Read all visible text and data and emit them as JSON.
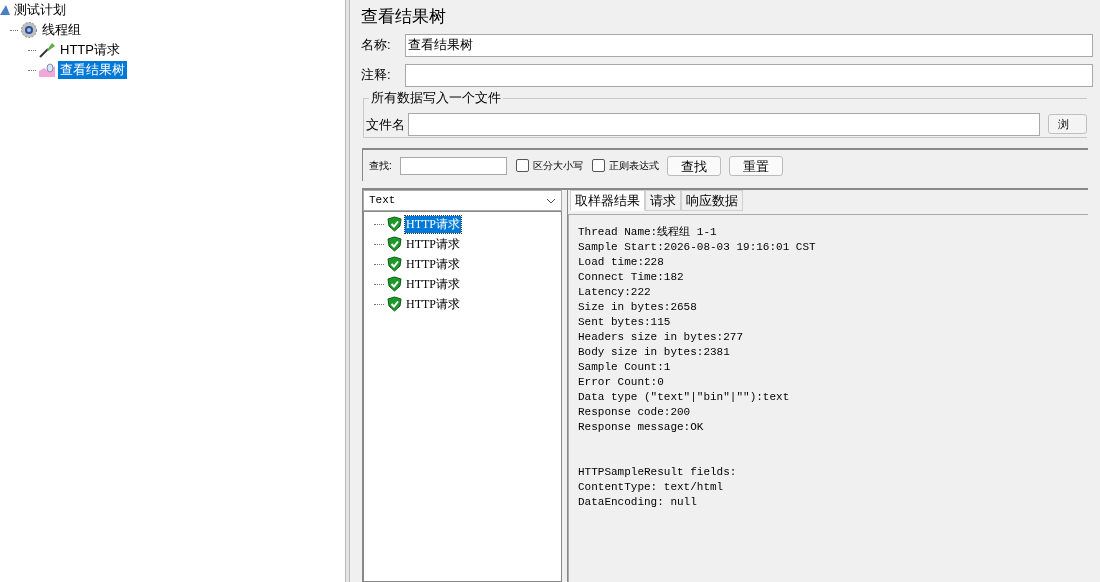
{
  "tree": [
    {
      "label": "测试计划",
      "kind": "plan",
      "selected": false,
      "children": [
        {
          "label": "线程组",
          "kind": "gear",
          "selected": false,
          "children": [
            {
              "label": "HTTP请求",
              "kind": "pipette",
              "selected": false
            },
            {
              "label": "查看结果树",
              "kind": "chart",
              "selected": true
            }
          ]
        }
      ]
    }
  ],
  "panel": {
    "title": "查看结果树",
    "name_label": "名称:",
    "name_value": "查看结果树",
    "comment_label": "注释:",
    "file_group": {
      "legend": "所有数据写入一个文件",
      "file_label": "文件名",
      "browse_button": "浏"
    }
  },
  "search": {
    "label": "查找:",
    "case_checkbox": {
      "label": "区分大小写",
      "checked": false
    },
    "regex_checkbox": {
      "label": "正则表达式",
      "checked": false
    },
    "find_button": "查找",
    "reset_button": "重置"
  },
  "renderer": {
    "value": "Text"
  },
  "results": [
    {
      "label": "HTTP请求",
      "selected": true,
      "success": true
    },
    {
      "label": "HTTP请求",
      "selected": false,
      "success": true
    },
    {
      "label": "HTTP请求",
      "selected": false,
      "success": true
    },
    {
      "label": "HTTP请求",
      "selected": false,
      "success": true
    },
    {
      "label": "HTTP请求",
      "selected": false,
      "success": true
    }
  ],
  "tabs": [
    {
      "label": "取样器结果",
      "selected": true
    },
    {
      "label": "请求",
      "selected": false
    },
    {
      "label": "响应数据",
      "selected": false
    }
  ],
  "sampler_result": {
    "lines": [
      "Thread Name:线程组 1-1",
      "Sample Start:2026-08-03 19:16:01 CST",
      "Load time:228",
      "Connect Time:182",
      "Latency:222",
      "Size in bytes:2658",
      "Sent bytes:115",
      "Headers size in bytes:277",
      "Body size in bytes:2381",
      "Sample Count:1",
      "Error Count:0",
      "Data type (\"text\"|\"bin\"|\"\"):text",
      "Response code:200",
      "Response message:OK"
    ],
    "field_lines": [
      "HTTPSampleResult fields:",
      "ContentType: text/html",
      "DataEncoding: null"
    ]
  }
}
